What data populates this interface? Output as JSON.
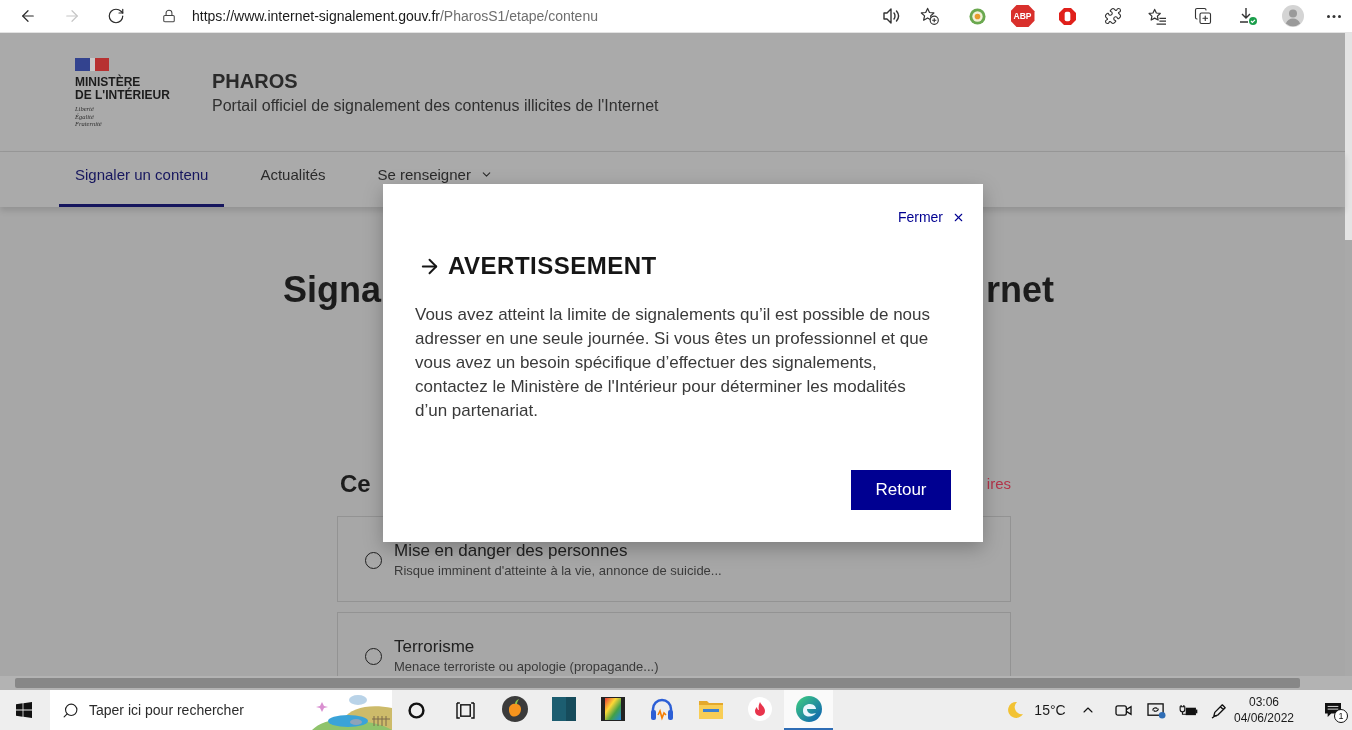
{
  "browser": {
    "nav_buttons": [
      {
        "kind": "back",
        "disabled": false
      },
      {
        "kind": "forward",
        "disabled": true
      },
      {
        "kind": "reload",
        "disabled": false
      }
    ],
    "url_host": "https://www.internet-signalement.gouv.fr",
    "url_path": "/PharosS1/etape/contenu",
    "adblock_label": "ABP"
  },
  "header": {
    "ministry_lines": [
      "MINISTÈRE",
      "DE L'INTÉRIEUR"
    ],
    "motto_lines": [
      "Liberté",
      "Égalité",
      "Fraternité"
    ],
    "site_title": "PHAROS",
    "site_subtitle": "Portail officiel de signalement des contenus illicites de l'Internet"
  },
  "nav": [
    {
      "label": "Signaler un contenu",
      "selected": true,
      "dropdown": false
    },
    {
      "label": "Actualités",
      "selected": false,
      "dropdown": false
    },
    {
      "label": "Se renseigner",
      "selected": false,
      "dropdown": true
    }
  ],
  "page": {
    "title_visible_parts": [
      "Signa",
      "rnet"
    ],
    "question": "Ce",
    "required_note": "ires",
    "options": [
      {
        "label": "Mise en danger des personnes",
        "hint": "Risque imminent d'atteinte à la vie, annonce de suicide...",
        "selected": false
      },
      {
        "label": "Terrorisme",
        "hint": "Menace terroriste ou apologie (propagande...)",
        "selected": false
      }
    ]
  },
  "modal": {
    "close_label": "Fermer",
    "title": "AVERTISSEMENT",
    "body": "Vous avez atteint la limite de signalements qu’il est possible de nous adresser en une seule journée. Si vous êtes un professionnel et que vous avez un besoin spécifique d’effectuer des signalements, contactez le Ministère de l'Intérieur pour déterminer les modalités d’un partenariat.",
    "button": "Retour"
  },
  "taskbar": {
    "search": {
      "placeholder": "Taper ici pour rechercher"
    },
    "apps": [
      {
        "kind": "fruit",
        "selected": false
      },
      {
        "kind": "tiles",
        "selected": false
      },
      {
        "kind": "film",
        "selected": false
      },
      {
        "kind": "headphones",
        "selected": false
      },
      {
        "kind": "folder",
        "selected": false
      },
      {
        "kind": "flame",
        "selected": false
      },
      {
        "kind": "swirl",
        "selected": true
      }
    ],
    "weather": "15°C",
    "time": "03:06",
    "date": "04/06/2022",
    "notification_count": "1"
  }
}
